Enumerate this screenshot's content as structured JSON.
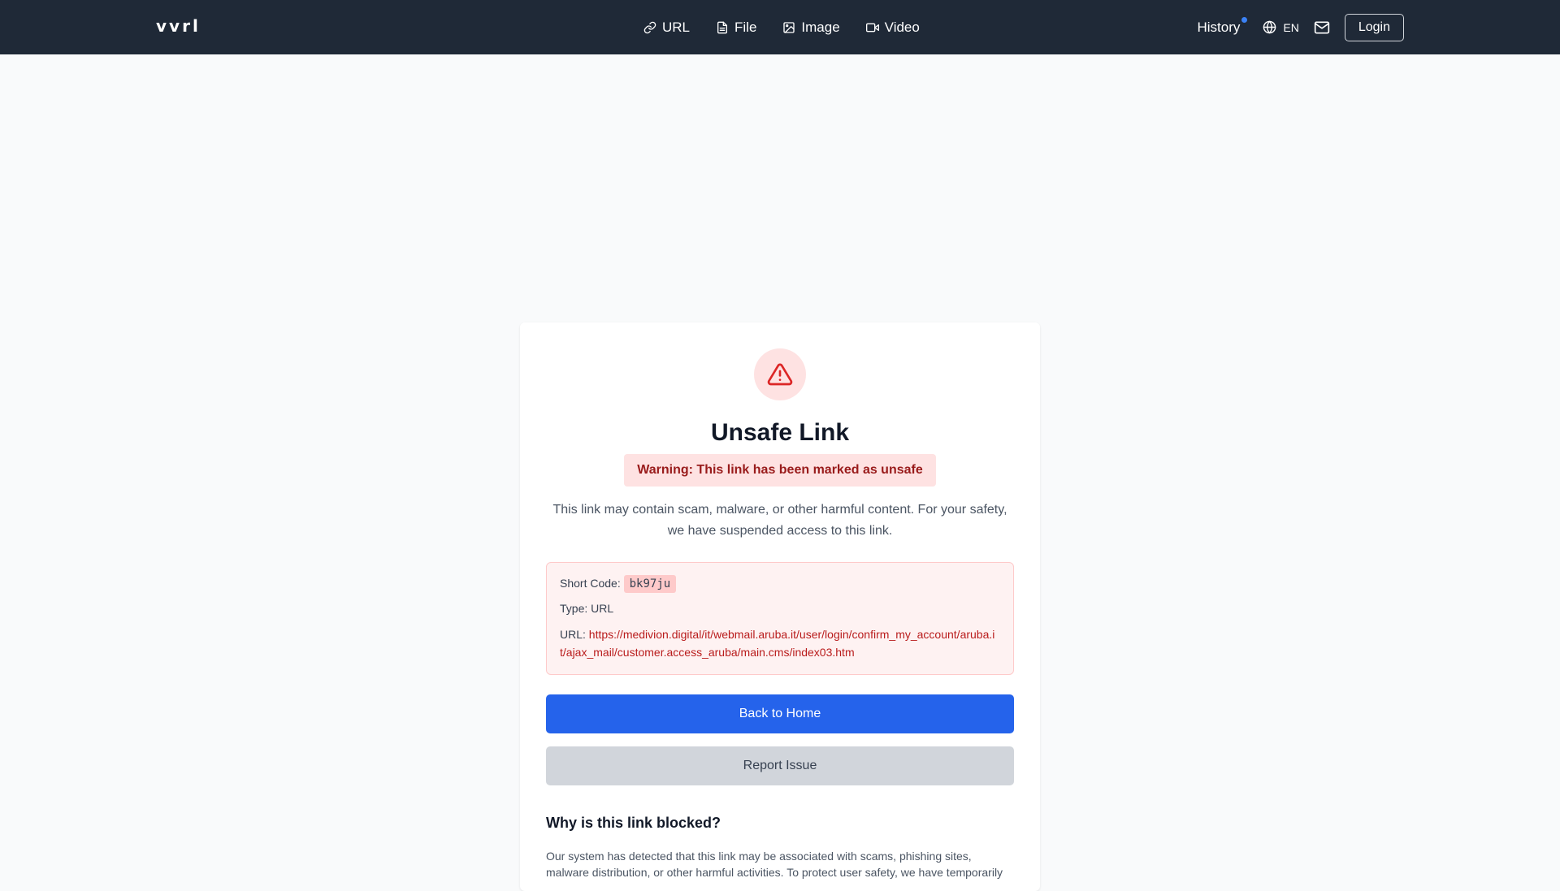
{
  "header": {
    "brand": "vvrl",
    "nav": [
      {
        "label": "URL",
        "icon": "link-icon"
      },
      {
        "label": "File",
        "icon": "file-icon"
      },
      {
        "label": "Image",
        "icon": "image-icon"
      },
      {
        "label": "Video",
        "icon": "video-icon"
      }
    ],
    "history_label": "History",
    "language": "EN",
    "login_label": "Login"
  },
  "card": {
    "title": "Unsafe Link",
    "warning": "Warning: This link has been marked as unsafe",
    "description": "This link may contain scam, malware, or other harmful content. For your safety, we have suspended access to this link.",
    "details": {
      "short_code_label": "Short Code:",
      "short_code": "bk97ju",
      "type_label": "Type:",
      "type_value": "URL",
      "url_label": "URL:",
      "url_value": "https://medivion.digital/it/webmail.aruba.it/user/login/confirm_my_account/aruba.it/ajax_mail/customer.access_aruba/main.cms/index03.htm"
    },
    "back_label": "Back to Home",
    "report_label": "Report Issue",
    "why_title": "Why is this link blocked?",
    "why_text": "Our system has detected that this link may be associated with scams, phishing sites, malware distribution, or other harmful activities. To protect user safety, we have temporarily"
  },
  "colors": {
    "topbar": "#1f2937",
    "primary": "#2563eb",
    "danger_bg": "#fee2e2",
    "danger_text": "#991b1b",
    "history_dot": "#3b82f6"
  }
}
